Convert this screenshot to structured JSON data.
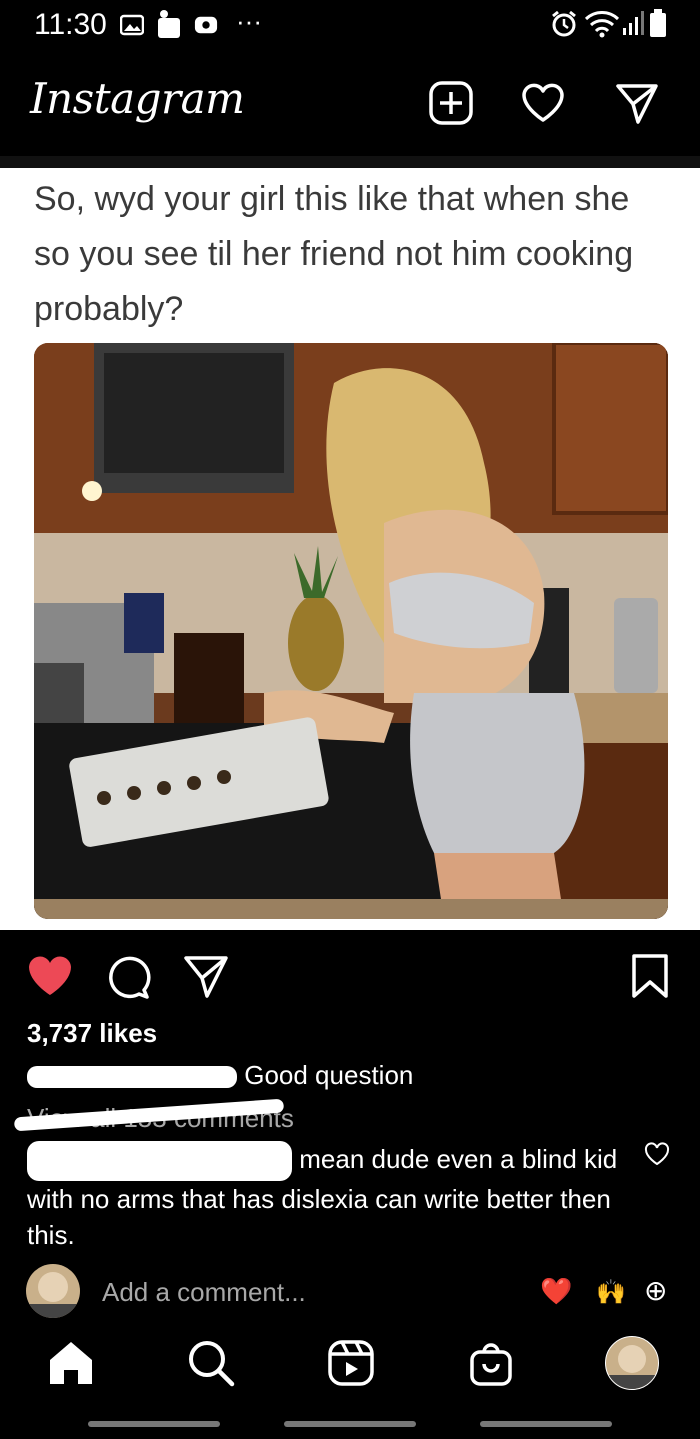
{
  "status_bar": {
    "time": "11:30",
    "more": "···"
  },
  "header": {
    "logo": "Instagram",
    "icons": [
      "add-post-icon",
      "heart-icon",
      "direct-send-icon"
    ]
  },
  "post": {
    "caption_image_text": "So, wyd your girl this like that when she so you see til her friend not him cooking probably?",
    "likes": "3,737 likes",
    "comment_1": "Good question",
    "view_all": "View all 153 comments",
    "comment_2": "mean dude even a blind kid with no arms that has dislexia can write better then this.",
    "add_comment_placeholder": "Add a comment...",
    "quick_reactions": [
      "❤️",
      "🙌",
      "⊕"
    ],
    "liked_color": "#ed4956"
  },
  "nav": [
    "home-icon",
    "search-icon",
    "reels-icon",
    "shop-icon",
    "profile-avatar"
  ]
}
